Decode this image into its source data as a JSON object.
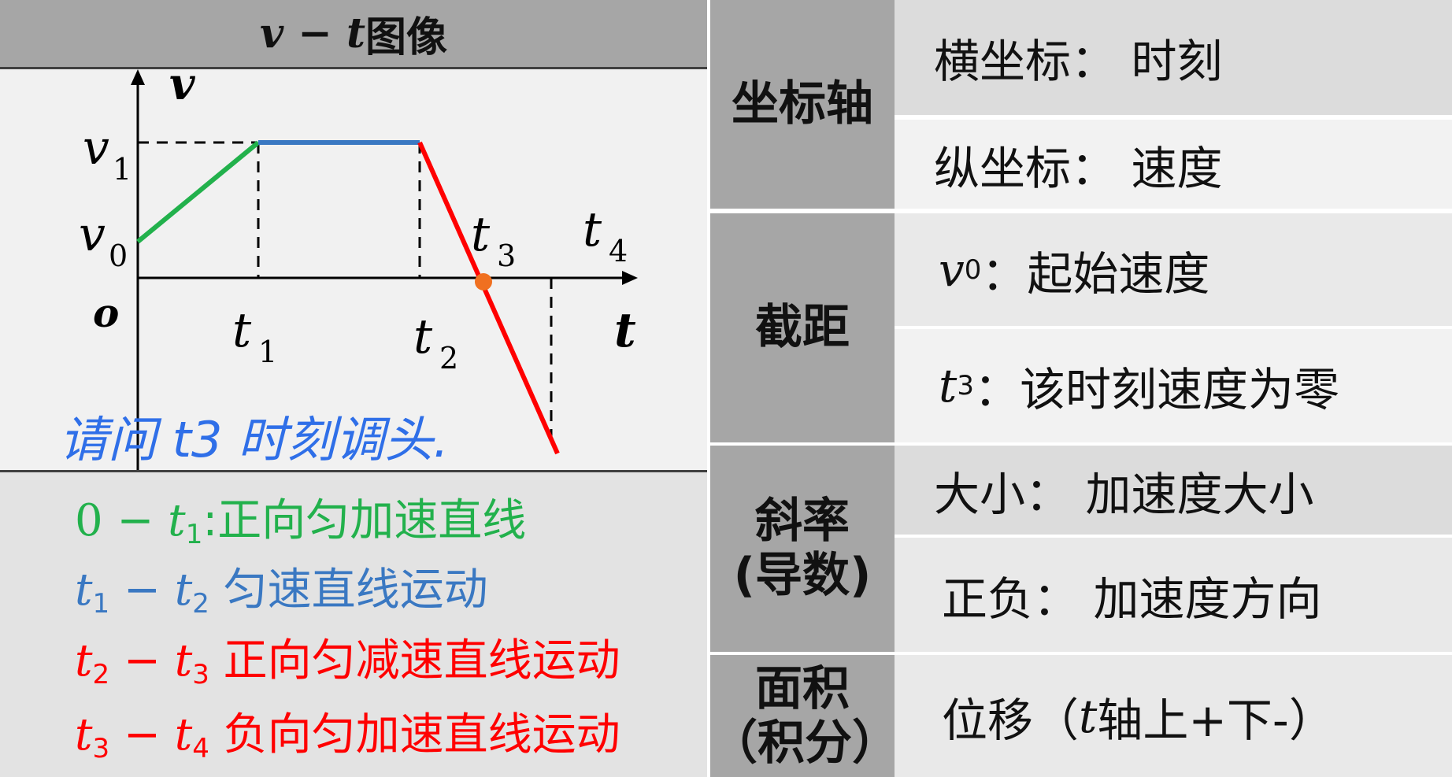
{
  "left": {
    "title_var": "v − t",
    "title_text": "图像",
    "graph": {
      "v_axis": "v",
      "t_axis": "t",
      "origin": "o",
      "v0": "0",
      "v1": "1",
      "t1": "1",
      "t2": "2",
      "t3": "3",
      "t4": "4",
      "var_v": "v",
      "var_t": "t",
      "handwritten_note": "请问 t3 时刻调头."
    },
    "legend": [
      {
        "from_var": "0",
        "from_sub": "",
        "dash": " − ",
        "to_var": "t",
        "to_sub": "1",
        "text": ":正向匀加速直线",
        "color": "#22b14c"
      },
      {
        "from_var": "t",
        "from_sub": "1",
        "dash": " − ",
        "to_var": "t",
        "to_sub": "2",
        "text": " 匀速直线运动",
        "color": "#3a78c2"
      },
      {
        "from_var": "t",
        "from_sub": "2",
        "dash": " − ",
        "to_var": "t",
        "to_sub": "3",
        "text": " 正向匀减速直线运动",
        "color": "#ff0000"
      },
      {
        "from_var": "t",
        "from_sub": "3",
        "dash": " − ",
        "to_var": "t",
        "to_sub": "4",
        "text": " 负向匀加速直线运动",
        "color": "#ff0000"
      }
    ],
    "colors": {
      "segment1": "#22b14c",
      "segment2": "#3a78c2",
      "segment3": "#ff0000",
      "handwriting": "#2f6fe8",
      "marker": "#f07020"
    }
  },
  "table": {
    "axes": {
      "header": "坐标轴",
      "rows": [
        {
          "label": "横坐标：",
          "value": "时刻"
        },
        {
          "label": "纵坐标：",
          "value": "速度"
        }
      ]
    },
    "intercept": {
      "header": "截距",
      "rows": [
        {
          "var": "v",
          "sub": "0",
          "text": "：起始速度"
        },
        {
          "var": "t",
          "sub": "3",
          "text": "：该时刻速度为零"
        }
      ]
    },
    "slope": {
      "header_line1": "斜率",
      "header_line2": "(导数)",
      "rows": [
        {
          "label": "大小：",
          "value": "加速度大小"
        },
        {
          "label": "正负：",
          "value": "加速度方向"
        }
      ]
    },
    "area": {
      "header_line1": "面积",
      "header_line2": "（积分）",
      "rows": [
        {
          "prefix": "位移（",
          "var": "t",
          "suffix": "轴上+下-）"
        }
      ]
    }
  }
}
